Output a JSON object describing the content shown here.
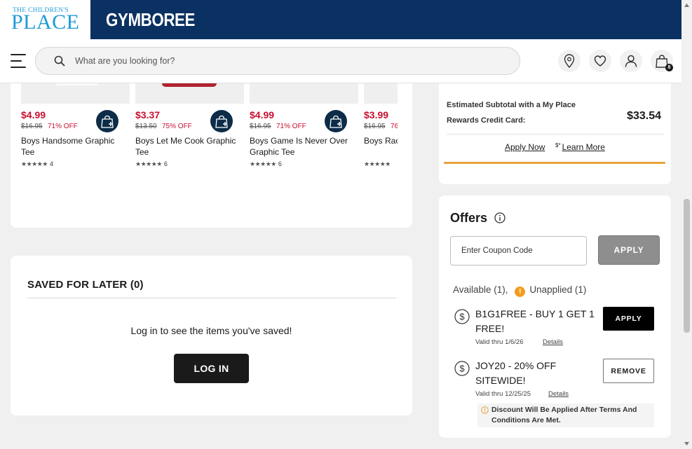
{
  "brand": {
    "tcp_logo_top": "THE CHILDREN'S",
    "tcp_logo_main": "PLACE",
    "gymboree_logo": "GYMBOREE"
  },
  "header": {
    "search_placeholder": "What are you looking for?",
    "icons": [
      "menu-icon",
      "search-icon",
      "location-pin-icon",
      "heart-icon",
      "account-icon",
      "shopping-bag-icon"
    ],
    "bag_count": "8"
  },
  "products": [
    {
      "price": "$4.99",
      "original_price": "$16.95",
      "discount": "71% OFF",
      "name": "Boys Handsome Graphic Tee",
      "stars": "★★★★★",
      "reviews": "4"
    },
    {
      "price": "$3.37",
      "original_price": "$13.50",
      "discount": "75% OFF",
      "name": "Boys Let Me Cook Graphic Tee",
      "stars": "★★★★★",
      "reviews": "6"
    },
    {
      "price": "$4.99",
      "original_price": "$16.95",
      "discount": "71% OFF",
      "name": "Boys Game Is Never Over Graphic Tee",
      "stars": "★★★★★",
      "reviews": "6"
    },
    {
      "price": "$3.99",
      "original_price": "$16.95",
      "discount": "76",
      "name": "Boys Rac",
      "stars": "★★★★★",
      "reviews": ""
    }
  ],
  "saved_for_later": {
    "title": "SAVED FOR LATER (0)",
    "message": "Log in to see the items you've saved!",
    "login_label": "LOG IN"
  },
  "rewards": {
    "label": "Estimated Subtotal with a My Place Rewards Credit Card:",
    "amount": "$33.54",
    "apply_now": "Apply Now",
    "learn_more_prefix": "$*",
    "learn_more": "Learn More",
    "accent_color": "#e8a33d"
  },
  "offers": {
    "title": "Offers",
    "coupon_placeholder": "Enter Coupon Code",
    "apply_label": "APPLY",
    "available_label": "Available (1),",
    "unapplied_icon": "!",
    "unapplied_label": "Unapplied (1)",
    "items": [
      {
        "name": "B1G1FREE - BUY 1 GET 1 FREE!",
        "valid": "Valid thru 1/6/26",
        "details": "Details",
        "action": "APPLY"
      },
      {
        "name": "JOY20 - 20% OFF SITEWIDE!",
        "valid": "Valid thru 12/25/25",
        "details": "Details",
        "action": "REMOVE"
      }
    ],
    "notice": "Discount Will Be Applied After Terms And Conditions Are Met."
  },
  "colors": {
    "brand_navy": "#0a3161",
    "sale_red": "#c8102e",
    "tcp_blue": "#1d9ad6",
    "unapplied_orange": "#f29d1e"
  }
}
